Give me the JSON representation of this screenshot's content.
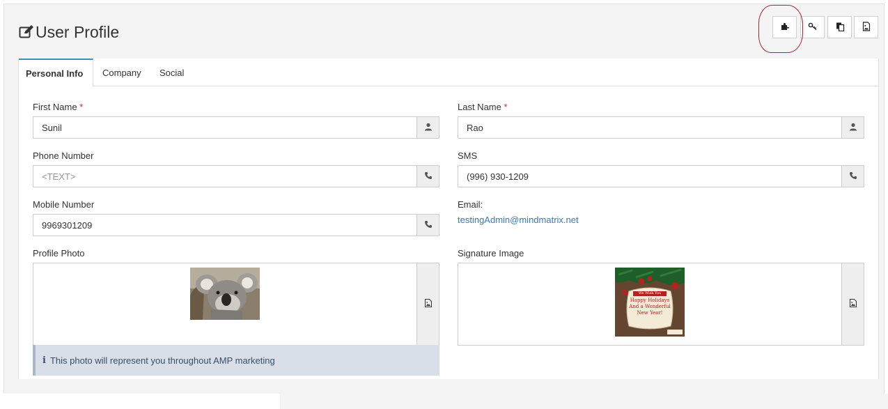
{
  "page": {
    "title": "User Profile"
  },
  "tabs": [
    {
      "label": "Personal Info",
      "active": true
    },
    {
      "label": "Company",
      "active": false
    },
    {
      "label": "Social",
      "active": false
    }
  ],
  "toolbar": {
    "icons": [
      "puzzle-plugin-icon",
      "key-icon",
      "copy-icon",
      "image-file-icon"
    ]
  },
  "form": {
    "first_name": {
      "label": "First Name",
      "required_mark": "*",
      "value": "Sunil",
      "icon": "user-icon"
    },
    "last_name": {
      "label": "Last Name",
      "required_mark": "*",
      "value": "Rao",
      "icon": "user-icon"
    },
    "phone": {
      "label": "Phone Number",
      "placeholder": "<TEXT>",
      "value": "",
      "icon": "phone-icon"
    },
    "sms": {
      "label": "SMS",
      "value": "(996) 930-1209",
      "icon": "phone-icon"
    },
    "mobile": {
      "label": "Mobile Number",
      "value": "9969301209",
      "icon": "phone-icon"
    },
    "email": {
      "label": "Email:",
      "value": "testingAdmin@mindmatrix.net"
    },
    "profile_photo": {
      "label": "Profile Photo",
      "icon": "image-icon"
    },
    "signature_image": {
      "label": "Signature Image",
      "icon": "image-icon",
      "card_text": [
        "We Wish You",
        "Happy Holidays",
        "And a Wonderful",
        "New Year!"
      ]
    },
    "photo_note": "This photo will represent you throughout AMP marketing"
  },
  "colors": {
    "accent": "#3c8dbc",
    "link": "#3c78b4",
    "required": "#c9302c",
    "highlight_circle": "#b0232a"
  }
}
